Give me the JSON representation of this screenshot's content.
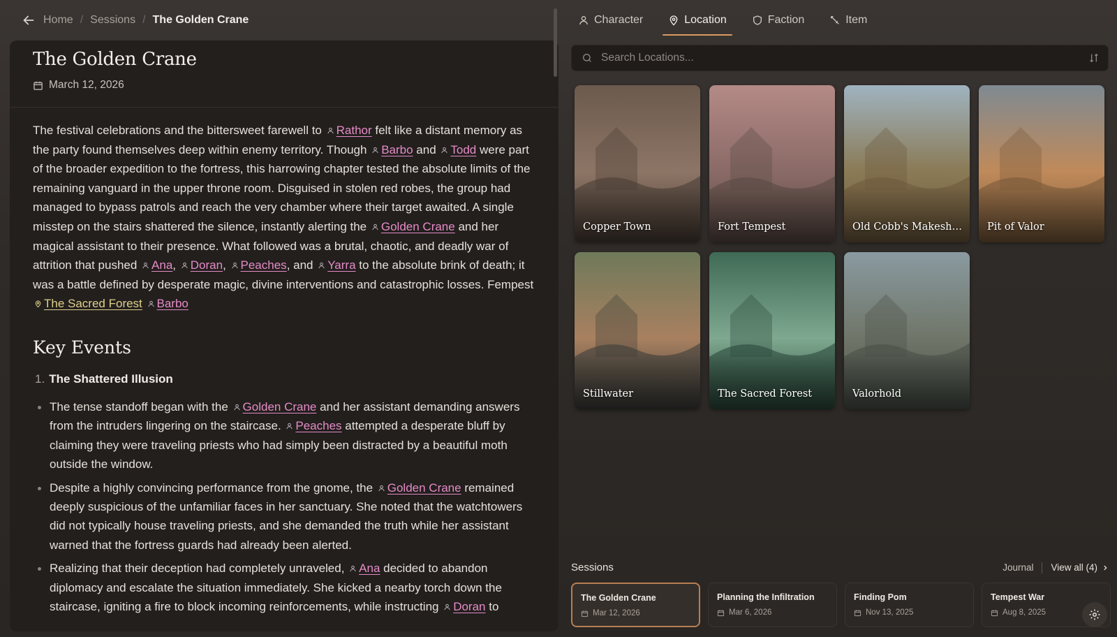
{
  "breadcrumb": {
    "home": "Home",
    "sessions": "Sessions",
    "current": "The Golden Crane",
    "sep": "/"
  },
  "document": {
    "title": "The Golden Crane",
    "date": "March 12, 2026",
    "paragraph": [
      {
        "t": "The festival celebrations and the bittersweet farewell to "
      },
      {
        "m": "Rathor"
      },
      {
        "t": " felt like a distant memory as the party found themselves deep within enemy territory. Though "
      },
      {
        "m": "Barbo"
      },
      {
        "t": " and "
      },
      {
        "m": "Todd"
      },
      {
        "t": " were part of the broader expedition to the fortress, this harrowing chapter tested the absolute limits of the remaining vanguard in the upper throne room. Disguised in stolen red robes, the group had managed to bypass patrols and reach the very chamber where their target awaited. A single misstep on the stairs shattered the silence, instantly alerting the "
      },
      {
        "m": "Golden Crane"
      },
      {
        "t": " and her magical assistant to their presence. What followed was a brutal, chaotic, and deadly war of attrition that pushed "
      },
      {
        "m": "Ana"
      },
      {
        "t": ", "
      },
      {
        "m": "Doran"
      },
      {
        "t": ", "
      },
      {
        "m": "Peaches"
      },
      {
        "t": ", and "
      },
      {
        "m": "Yarra"
      },
      {
        "t": " to the absolute brink of death; it was a battle defined by desperate magic, divine interventions and catastrophic losses. Fempest "
      },
      {
        "l": "The Sacred Forest"
      },
      {
        "t": " "
      },
      {
        "m": "Barbo"
      }
    ],
    "section_title": "Key Events",
    "ordered_num": "1.",
    "ordered_title": "The Shattered Illusion",
    "bullets": [
      [
        {
          "t": "The tense standoff began with the "
        },
        {
          "m": "Golden Crane"
        },
        {
          "t": " and her assistant demanding answers from the intruders lingering on the staircase. "
        },
        {
          "m": "Peaches"
        },
        {
          "t": " attempted a desperate bluff by claiming they were traveling priests who had simply been distracted by a beautiful moth outside the window."
        }
      ],
      [
        {
          "t": "Despite a highly convincing performance from the gnome, the "
        },
        {
          "m": "Golden Crane"
        },
        {
          "t": " remained deeply suspicious of the unfamiliar faces in her sanctuary. She noted that the watchtowers did not typically house traveling priests, and she demanded the truth while her assistant warned that the fortress guards had already been alerted."
        }
      ],
      [
        {
          "t": "Realizing that their deception had completely unraveled, "
        },
        {
          "m": "Ana"
        },
        {
          "t": " decided to abandon diplomacy and escalate the situation immediately. She kicked a nearby torch down the staircase, igniting a fire to block incoming reinforcements, while instructing "
        },
        {
          "m": "Doran"
        },
        {
          "t": " to"
        }
      ]
    ]
  },
  "tabs": [
    {
      "label": "Character",
      "icon": "user-icon"
    },
    {
      "label": "Location",
      "icon": "map-pin-icon",
      "active": true
    },
    {
      "label": "Faction",
      "icon": "shield-icon"
    },
    {
      "label": "Item",
      "icon": "sword-icon"
    }
  ],
  "search": {
    "placeholder": "Search Locations..."
  },
  "locations": [
    {
      "name": "Copper Town",
      "colors": [
        "#6b5a4d",
        "#8d7566",
        "#4a3d35"
      ]
    },
    {
      "name": "Fort Tempest",
      "colors": [
        "#b48a86",
        "#8a6a66",
        "#5a4a44"
      ]
    },
    {
      "name": "Old Cobb's Makeshi...",
      "colors": [
        "#9fb3c0",
        "#8a7a55",
        "#6e5a3d"
      ]
    },
    {
      "name": "Pit of Valor",
      "colors": [
        "#7f8a92",
        "#c08a5a",
        "#7a5a3a"
      ]
    },
    {
      "name": "Stillwater",
      "colors": [
        "#6f7a5a",
        "#a88060",
        "#3e3e3a"
      ]
    },
    {
      "name": "The Sacred Forest",
      "colors": [
        "#3f6a55",
        "#7fa890",
        "#2c4a3c"
      ]
    },
    {
      "name": "Valorhold",
      "colors": [
        "#8a9aa0",
        "#6f7568",
        "#4a5048"
      ]
    }
  ],
  "sessions": {
    "title": "Sessions",
    "journal": "Journal",
    "view_all": "View all (4)",
    "items": [
      {
        "name": "The Golden Crane",
        "date": "Mar 12, 2026",
        "active": true
      },
      {
        "name": "Planning the Infiltration",
        "date": "Mar 6, 2026"
      },
      {
        "name": "Finding Pom",
        "date": "Nov 13, 2025"
      },
      {
        "name": "Tempest War",
        "date": "Aug 8, 2025"
      }
    ]
  },
  "colors": {
    "mention": "#e68bc7",
    "location_mention": "#e0d08a",
    "accent": "#d99a63"
  }
}
